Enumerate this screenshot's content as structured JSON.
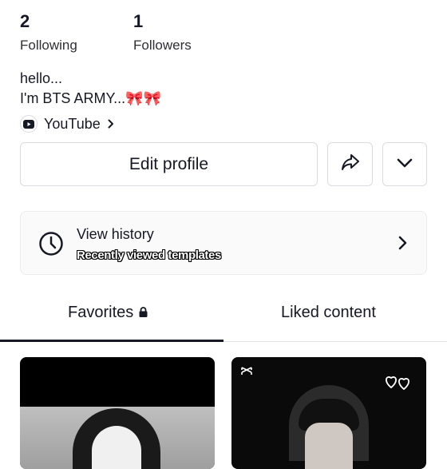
{
  "stats": {
    "following": {
      "count": "2",
      "label": "Following"
    },
    "followers": {
      "count": "1",
      "label": "Followers"
    }
  },
  "bio": {
    "line1": "hello...",
    "line2": "I'm BTS ARMY...🎀🎀"
  },
  "link": {
    "label": "YouTube",
    "icon": "youtube-icon"
  },
  "actions": {
    "edit_label": "Edit profile",
    "share_icon": "share-icon",
    "more_icon": "chevron-down-icon"
  },
  "history": {
    "title": "View history",
    "subtitle": "Recently viewed templates",
    "icon": "clock-icon"
  },
  "tabs": [
    {
      "label": "Favorites",
      "locked": true,
      "active": true
    },
    {
      "label": "Liked content",
      "locked": false,
      "active": false
    }
  ],
  "colors": {
    "text": "#161823",
    "border": "#dcdce0",
    "card_bg": "#fafafa"
  }
}
